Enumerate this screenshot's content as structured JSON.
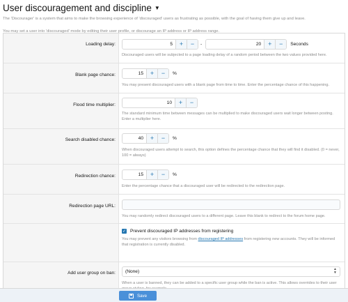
{
  "header": {
    "title": "User discouragement and discipline",
    "intro_1": "The 'Discourager' is a system that aims to make the browsing experience of 'discouraged' users as frustrating as possible, with the goal of having them give up and leave.",
    "intro_2": "You may set a user into 'discouraged' mode by editing their user profile, or discourage an IP address or IP address range."
  },
  "options": {
    "loading_delay": {
      "label": "Loading delay:",
      "min_value": "5",
      "separator": "-",
      "max_value": "20",
      "unit": "Seconds",
      "explain": "Discouraged users will be subjected to a page loading delay of a random period between the two values provided here."
    },
    "blank_page": {
      "label": "Blank page chance:",
      "value": "15",
      "unit": "%",
      "explain": "You may present discouraged users with a blank page from time to time. Enter the percentage chance of this happening."
    },
    "flood_time": {
      "label": "Flood time multiplier:",
      "value": "10",
      "explain": "The standard minimum time between messages can be multiplied to make discouraged users wait longer between posting. Enter a multiplier here."
    },
    "search_disabled": {
      "label": "Search disabled chance:",
      "value": "40",
      "unit": "%",
      "explain": "When discouraged users attempt to search, this option defines the percentage chance that they will find it disabled. (0 = never, 100 = always)"
    },
    "redirection": {
      "label": "Redirection chance:",
      "value": "15",
      "unit": "%",
      "explain": "Enter the percentage chance that a discouraged user will be redirected to the redirection page."
    },
    "redirection_url": {
      "label": "Redirection page URL:",
      "value": "",
      "explain": "You may randomly redirect discouraged users to a different page. Leave this blank to redirect to the forum home page."
    },
    "prevent_ip": {
      "label": "Prevent discouraged IP addresses from registering",
      "checked": true,
      "explain_pre": "You may prevent any visitors browsing from ",
      "explain_link": "discouraged IP addresses",
      "explain_post": " from registering new accounts. They will be informed that registration is currently disabled."
    },
    "ban_group": {
      "label": "Add user group on ban:",
      "selected": "(None)",
      "explain": "When a user is banned, they can be added to a specific user group while the ban is active. This allows overrides to their user group styling, for example."
    }
  },
  "icons": {
    "plus": "+",
    "minus": "−",
    "check": "✓"
  },
  "footer": {
    "save_label": "Save"
  },
  "colors": {
    "accent": "#2577b1",
    "save_button": "#4a90d9"
  }
}
